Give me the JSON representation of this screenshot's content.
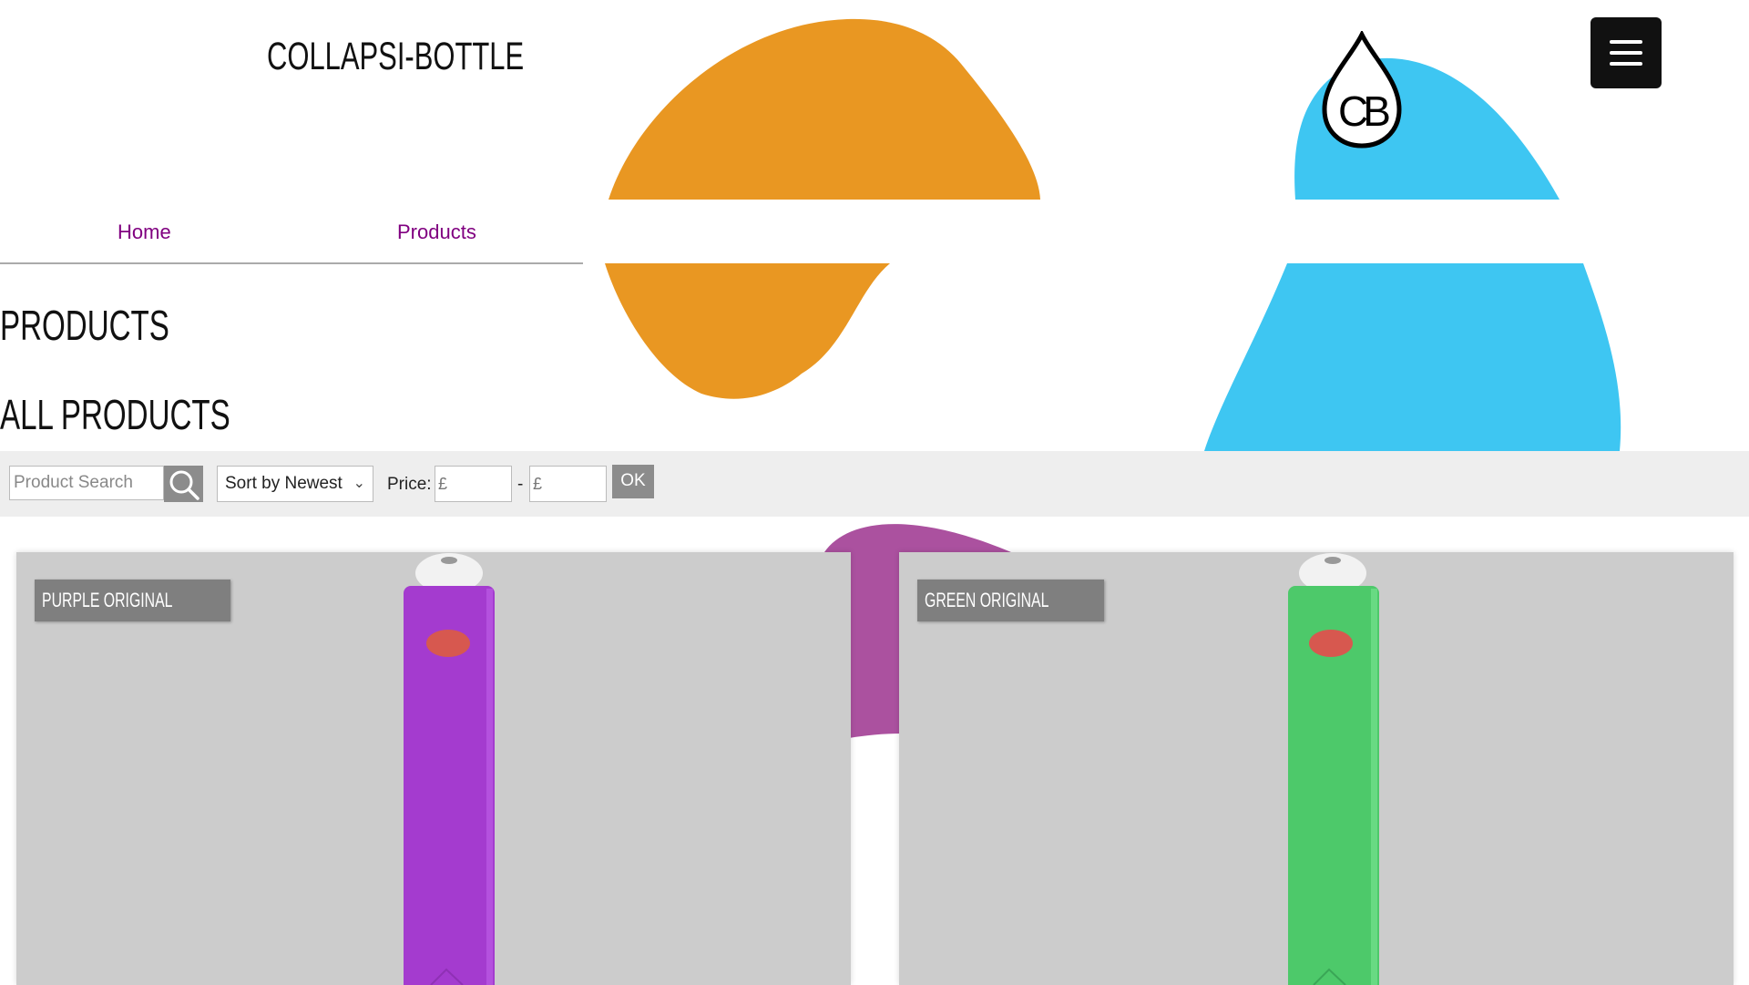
{
  "site": {
    "title": "COLLAPSI-BOTTLE",
    "logo_text": "CB"
  },
  "nav": {
    "items": [
      {
        "label": "Home"
      },
      {
        "label": "Products"
      }
    ]
  },
  "page": {
    "heading": "PRODUCTS",
    "subheading": "ALL PRODUCTS"
  },
  "filters": {
    "search_placeholder": "Product Search",
    "sort_value": "Sort by Newest",
    "price_label": "Price:",
    "price_min_placeholder": "£",
    "price_separator": "-",
    "price_max_placeholder": "£",
    "ok_label": "OK"
  },
  "products": [
    {
      "name": "PURPLE ORIGINAL",
      "color": "#a43bcf"
    },
    {
      "name": "GREEN ORIGINAL",
      "color": "#4dc96a"
    }
  ],
  "colors": {
    "orange_blob": "#e99722",
    "blue_blob": "#3ec6f2",
    "magenta_blob": "#ab519f",
    "nav_link": "#800080",
    "menu_button": "#111111"
  }
}
